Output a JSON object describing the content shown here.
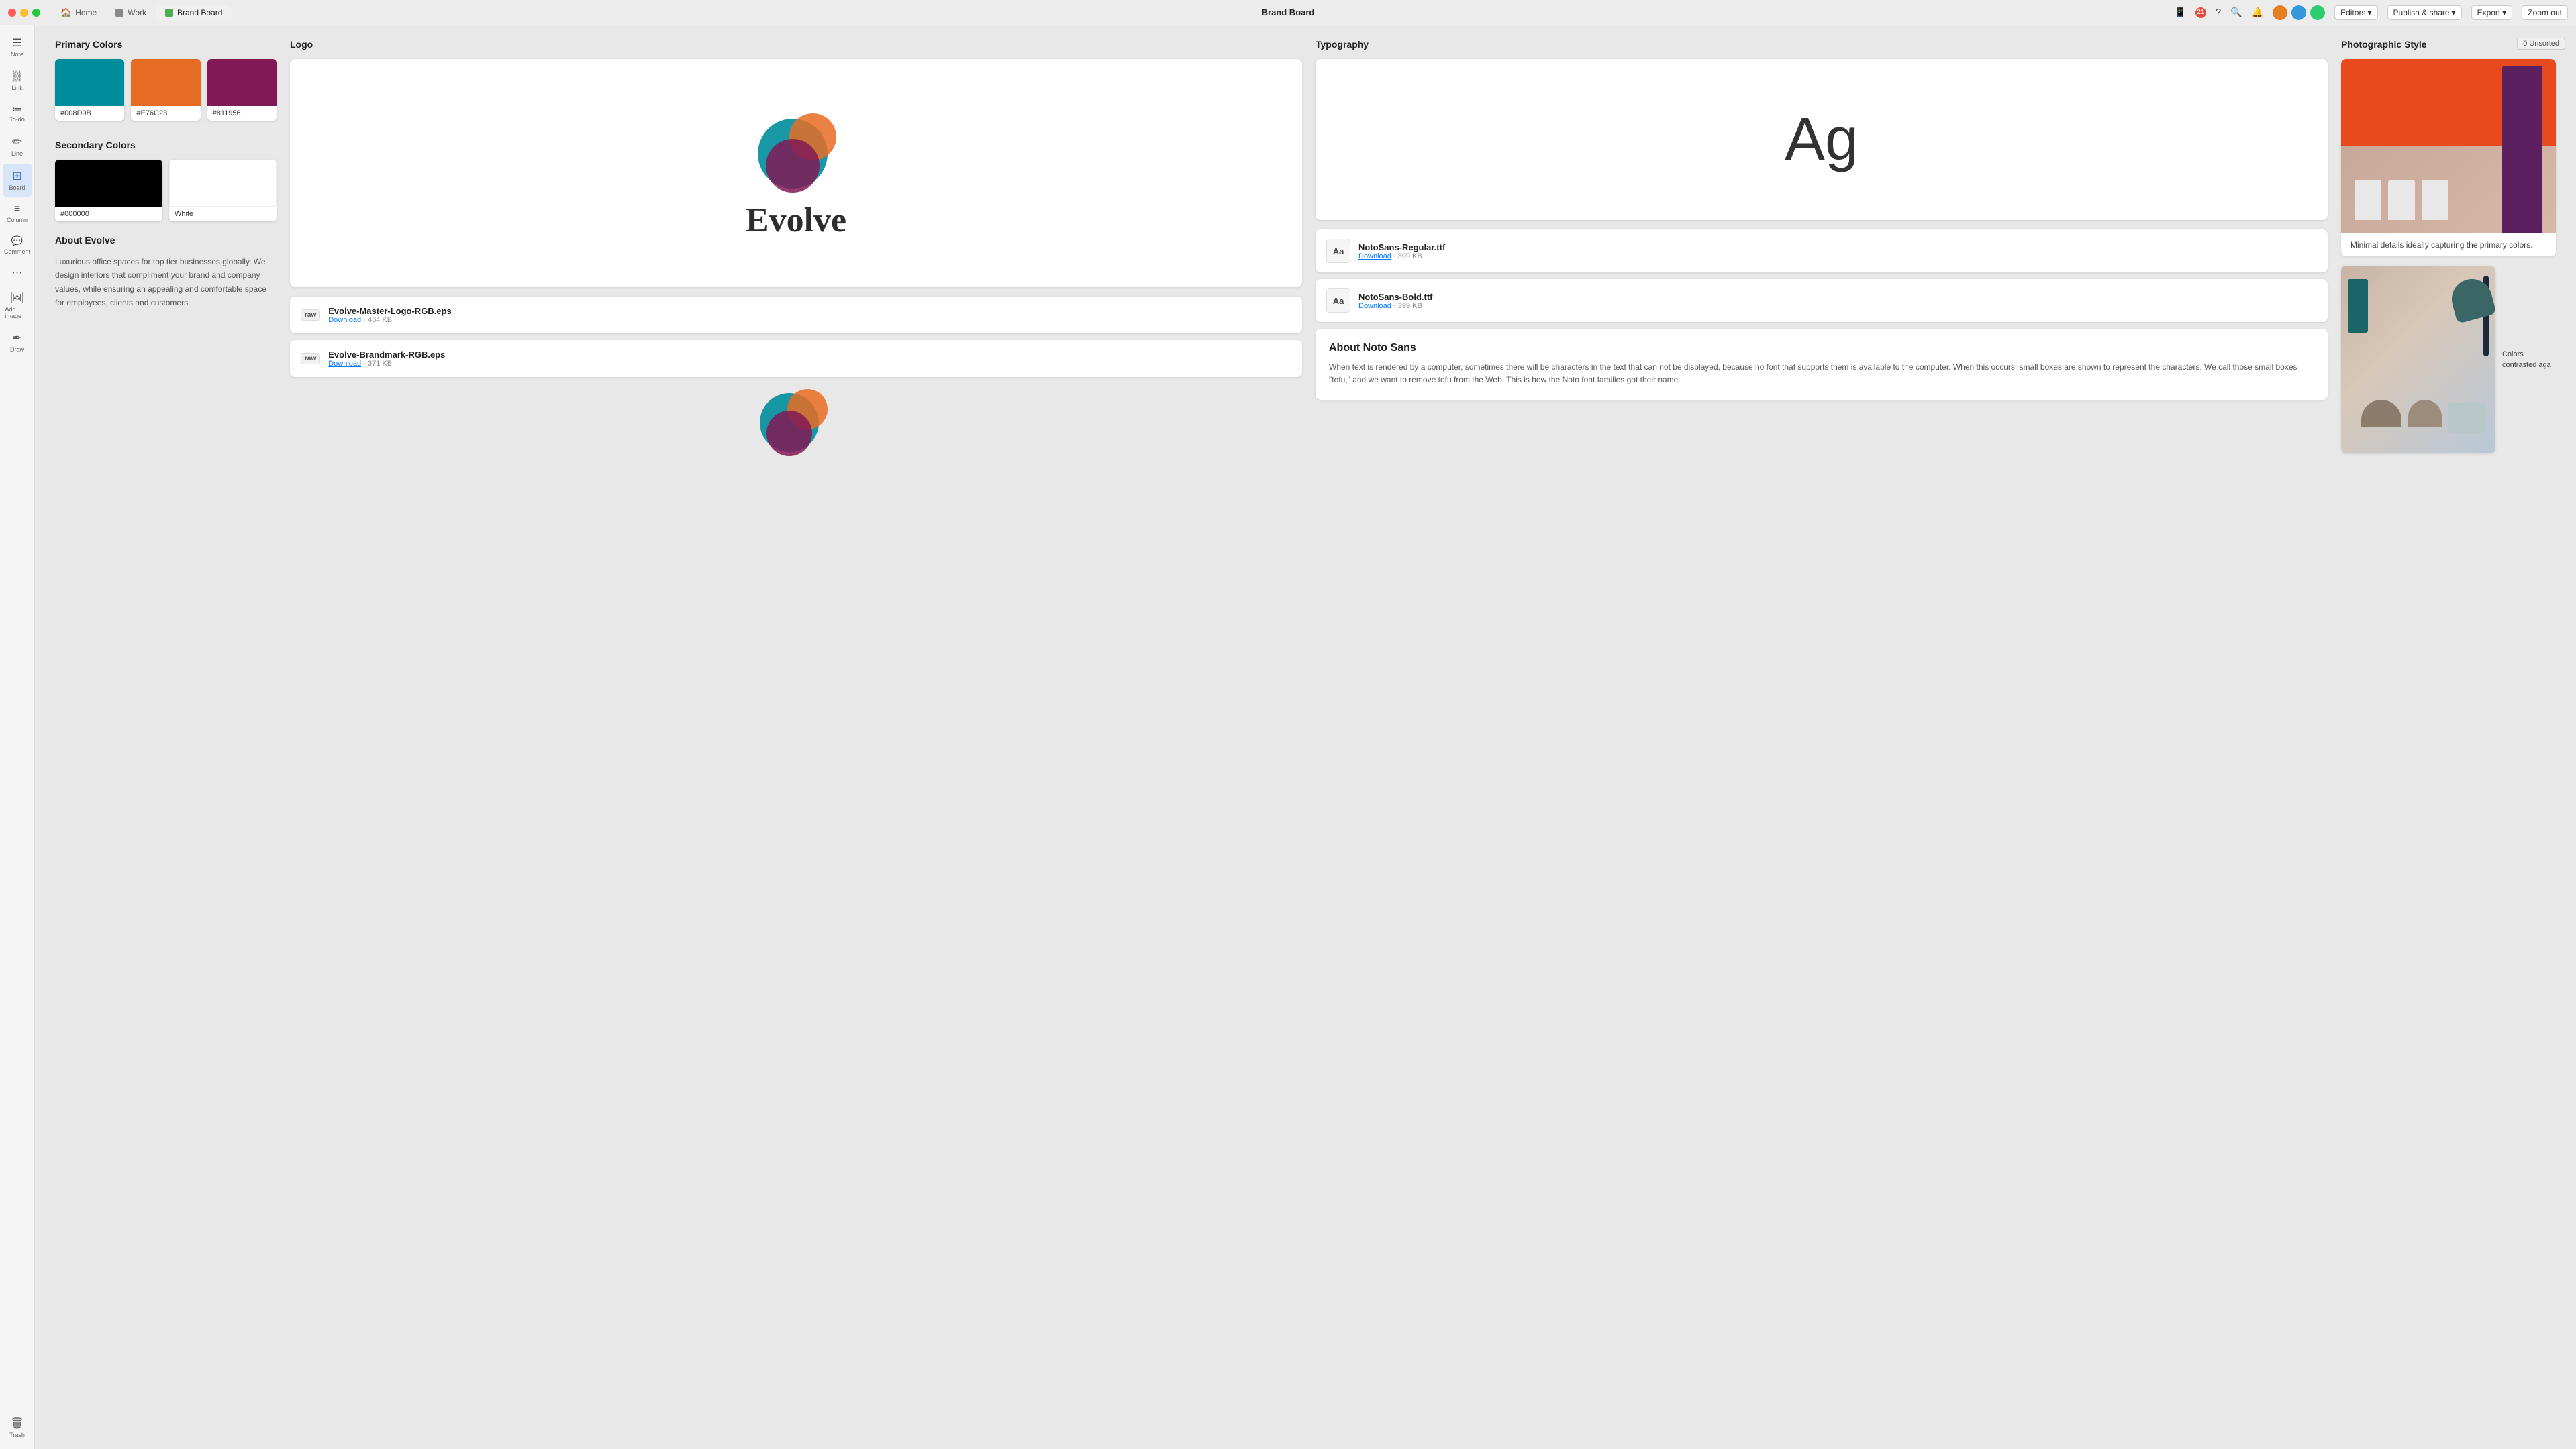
{
  "titleBar": {
    "appTitle": "Brand Board",
    "tabs": [
      {
        "id": "home",
        "label": "Home",
        "icon": "🏠",
        "active": false
      },
      {
        "id": "work",
        "label": "Work",
        "active": false
      },
      {
        "id": "brand-board",
        "label": "Brand Board",
        "active": true
      }
    ],
    "notificationCount": "21",
    "editorsLabel": "Editors",
    "publishLabel": "Publish & share",
    "exportLabel": "Export",
    "zoomLabel": "Zoom out",
    "unsortedLabel": "0 Unsorted"
  },
  "sidebar": {
    "items": [
      {
        "id": "note",
        "icon": "☰",
        "label": "Note"
      },
      {
        "id": "link",
        "icon": "🔗",
        "label": "Link"
      },
      {
        "id": "todo",
        "icon": "☑",
        "label": "To-do"
      },
      {
        "id": "line",
        "icon": "✏",
        "label": "Line"
      },
      {
        "id": "board",
        "icon": "⊞",
        "label": "Board",
        "active": true
      },
      {
        "id": "column",
        "icon": "≡",
        "label": "Column"
      },
      {
        "id": "comment",
        "icon": "💬",
        "label": "Comment"
      },
      {
        "id": "dots",
        "icon": "⋯",
        "label": ""
      },
      {
        "id": "add-image",
        "icon": "🖼",
        "label": "Add image"
      },
      {
        "id": "draw",
        "icon": "✒",
        "label": "Draw"
      }
    ],
    "trash": {
      "id": "trash",
      "icon": "🗑",
      "label": "Trash"
    }
  },
  "primaryColors": {
    "sectionTitle": "Primary Colors",
    "swatches": [
      {
        "color": "#008D9B",
        "label": "#008D9B"
      },
      {
        "color": "#E76C23",
        "label": "#E76C23"
      },
      {
        "color": "#811956",
        "label": "#811956"
      }
    ]
  },
  "secondaryColors": {
    "sectionTitle": "Secondary Colors",
    "swatches": [
      {
        "color": "#000000",
        "label": "#000000"
      },
      {
        "color": "#FFFFFF",
        "label": "White"
      }
    ]
  },
  "about": {
    "title": "About Evolve",
    "text": "Luxurious office spaces for top tier businesses globally. We design interiors that compliment your brand and company values, while ensuring an appealing and comfortable space for employees, clients and customers."
  },
  "logo": {
    "sectionTitle": "Logo",
    "brandName": "Evolve",
    "files": [
      {
        "name": "Evolve-Master-Logo-RGB.eps",
        "downloadLabel": "Download",
        "size": "464 KB"
      },
      {
        "name": "Evolve-Brandmark-RGB.eps",
        "downloadLabel": "Download",
        "size": "371 KB"
      }
    ]
  },
  "typography": {
    "sectionTitle": "Typography",
    "sampleText": "Ag",
    "fonts": [
      {
        "name": "NotoSans-Regular.ttf",
        "downloadLabel": "Download",
        "size": "399 KB"
      },
      {
        "name": "NotoSans-Bold.ttf",
        "downloadLabel": "Download",
        "size": "399 KB"
      }
    ],
    "aboutTitle": "About Noto Sans",
    "aboutText": "When text is rendered by a computer, sometimes there will be characters in the text that can not be displayed, because no font that supports them is available to the computer. When this occurs, small boxes are shown to represent the characters. We call those small boxes \"tofu,\" and we want to remove tofu from the Web. This is how the Noto font families got their name."
  },
  "photographic": {
    "sectionTitle": "Photographic Style",
    "caption1": "Minimal details ideally capturing the primary colors.",
    "caption2": "Colors contrasted aga"
  }
}
